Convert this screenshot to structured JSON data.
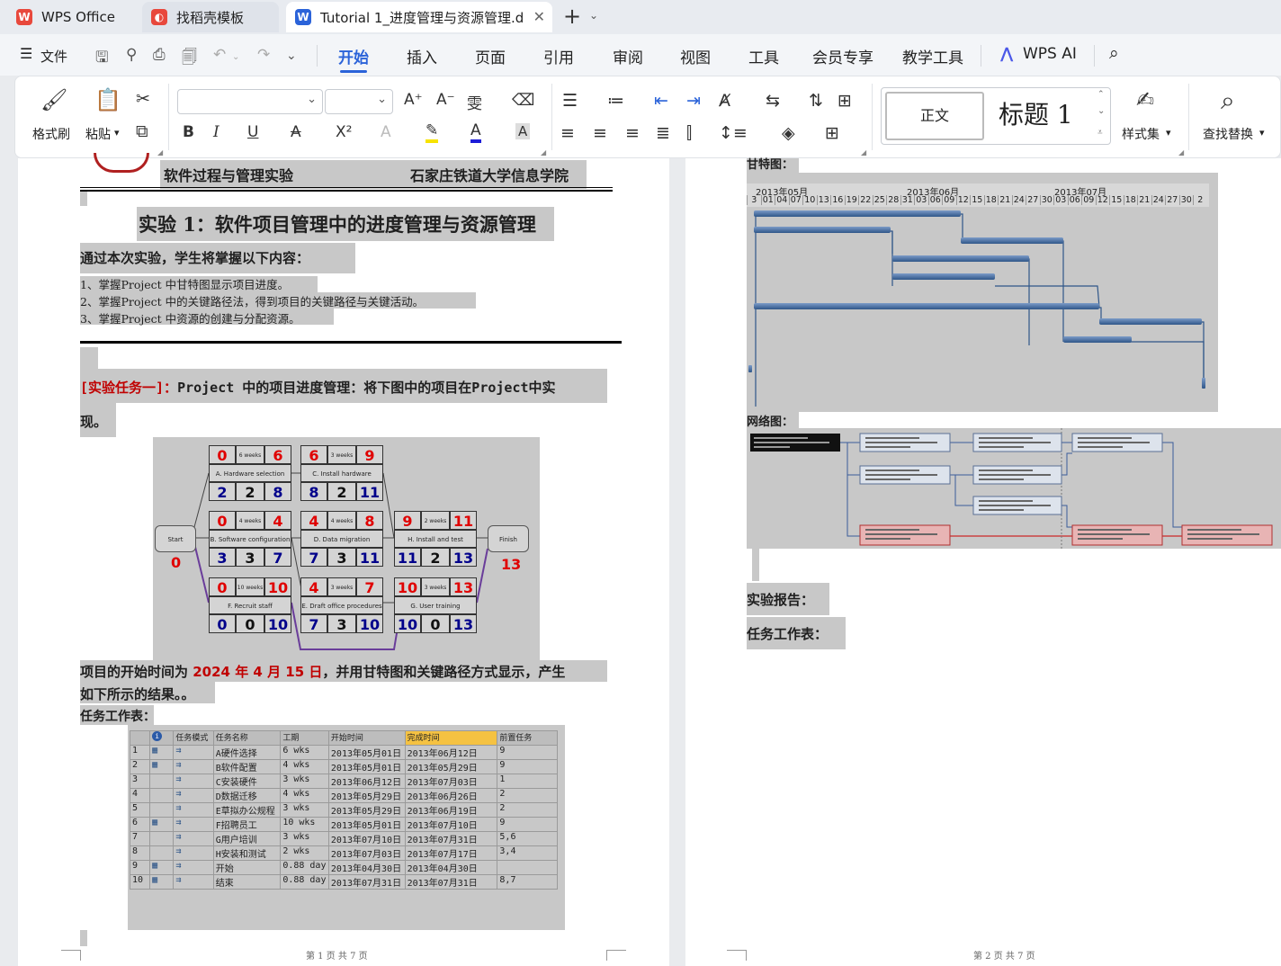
{
  "tabs": [
    {
      "label": "WPS Office"
    },
    {
      "label": "找稻壳模板"
    },
    {
      "label": "Tutorial 1_进度管理与资源管理.d"
    }
  ],
  "menu": {
    "file": "文件",
    "items": [
      "开始",
      "插入",
      "页面",
      "引用",
      "审阅",
      "视图",
      "工具",
      "会员专享",
      "教学工具"
    ],
    "ai": "WPS AI"
  },
  "ribbon": {
    "format_painter": "格式刷",
    "paste": "粘贴",
    "style_normal": "正文",
    "style_heading": "标题 1",
    "style_set": "样式集",
    "find_replace": "查找替换"
  },
  "colors": {
    "accent": "#2b63d9",
    "red": "#c00000",
    "blue": "#00008b",
    "highlight": "#c8c8c8"
  },
  "page1": {
    "header_left": "软件过程与管理实验",
    "header_right": "石家庄铁道大学信息学院",
    "title": "实验 1：软件项目管理中的进度管理与资源管理",
    "intro": "通过本次实验，学生将掌握以下内容：",
    "items": [
      "1、掌握Project 中甘特图显示项目进度。",
      "2、掌握Project 中的关键路径法，得到项目的关键路径与关键活动。",
      "3、掌握Project 中资源的创建与分配资源。"
    ],
    "task_red": "[实验任务一]：",
    "task_text": "Project 中的项目进度管理：将下图中的项目在Project中实",
    "task_text2": "现。",
    "net": {
      "start": "Start",
      "finish": "Finish",
      "start_val": "0",
      "finish_val": "13",
      "nodes": [
        {
          "t": [
            "0",
            "6 weeks",
            "6"
          ],
          "name": "A. Hardware selection",
          "b": [
            "2",
            "2",
            "8"
          ]
        },
        {
          "t": [
            "6",
            "3 weeks",
            "9"
          ],
          "name": "C. Install hardware",
          "b": [
            "8",
            "2",
            "11"
          ]
        },
        {
          "t": [
            "0",
            "4 weeks",
            "4"
          ],
          "name": "B. Software configuration",
          "b": [
            "3",
            "3",
            "7"
          ]
        },
        {
          "t": [
            "4",
            "4 weeks",
            "8"
          ],
          "name": "D. Data migration",
          "b": [
            "7",
            "3",
            "11"
          ]
        },
        {
          "t": [
            "9",
            "2 weeks",
            "11"
          ],
          "name": "H. Install and test",
          "b": [
            "11",
            "2",
            "13"
          ]
        },
        {
          "t": [
            "0",
            "10 weeks",
            "10"
          ],
          "name": "F. Recruit staff",
          "b": [
            "0",
            "0",
            "10"
          ]
        },
        {
          "t": [
            "4",
            "3 weeks",
            "7"
          ],
          "name": "E. Draft office procedures",
          "b": [
            "7",
            "3",
            "10"
          ]
        },
        {
          "t": [
            "10",
            "3 weeks",
            "13"
          ],
          "name": "G. User training",
          "b": [
            "10",
            "0",
            "13"
          ]
        }
      ]
    },
    "start_pre": "项目的开始时间为 ",
    "start_date": "2024 年 4 月 15 日",
    "start_post": "，并用甘特图和关键路径方式显示，产生",
    "start_line2": "如下所示的结果。。",
    "task_sheet": "任务工作表：",
    "table": {
      "headers": [
        "任务模式",
        "任务名称",
        "工期",
        "开始时间",
        "完成时间",
        "前置任务"
      ],
      "rows": [
        {
          "id": "1",
          "name": "A硬件选择",
          "dur": "6 wks",
          "start": "2013年05月01日",
          "finish": "2013年06月12日",
          "pred": "9"
        },
        {
          "id": "2",
          "name": "B软件配置",
          "dur": "4 wks",
          "start": "2013年05月01日",
          "finish": "2013年05月29日",
          "pred": "9"
        },
        {
          "id": "3",
          "name": "C安装硬件",
          "dur": "3 wks",
          "start": "2013年06月12日",
          "finish": "2013年07月03日",
          "pred": "1"
        },
        {
          "id": "4",
          "name": "D数据迁移",
          "dur": "4 wks",
          "start": "2013年05月29日",
          "finish": "2013年06月26日",
          "pred": "2"
        },
        {
          "id": "5",
          "name": "E草拟办公规程",
          "dur": "3 wks",
          "start": "2013年05月29日",
          "finish": "2013年06月19日",
          "pred": "2"
        },
        {
          "id": "6",
          "name": "F招聘员工",
          "dur": "10 wks",
          "start": "2013年05月01日",
          "finish": "2013年07月10日",
          "pred": "9"
        },
        {
          "id": "7",
          "name": "G用户培训",
          "dur": "3 wks",
          "start": "2013年07月10日",
          "finish": "2013年07月31日",
          "pred": "5,6"
        },
        {
          "id": "8",
          "name": "H安装和测试",
          "dur": "2 wks",
          "start": "2013年07月03日",
          "finish": "2013年07月17日",
          "pred": "3,4"
        },
        {
          "id": "9",
          "name": "开始",
          "dur": "0.88 day",
          "start": "2013年04月30日",
          "finish": "2013年04月30日",
          "pred": ""
        },
        {
          "id": "10",
          "name": "结束",
          "dur": "0.88 day",
          "start": "2013年07月31日",
          "finish": "2013年07月31日",
          "pred": "8,7"
        }
      ]
    },
    "page_num": "第 1 页 共 7 页"
  },
  "page2": {
    "gantt_label": "甘特图：",
    "months": [
      "2013年05月",
      "2013年06月",
      "2013年07月"
    ],
    "days": [
      "3",
      "01",
      "04",
      "07",
      "10",
      "13",
      "16",
      "19",
      "22",
      "25",
      "28",
      "31",
      "03",
      "06",
      "09",
      "12",
      "15",
      "18",
      "21",
      "24",
      "27",
      "30",
      "03",
      "06",
      "09",
      "12",
      "15",
      "18",
      "21",
      "24",
      "27",
      "30",
      "2"
    ],
    "network_label": "网络图：",
    "report": "实验报告：",
    "task_sheet": "任务工作表：",
    "page_num": "第 2 页 共 7 页"
  }
}
